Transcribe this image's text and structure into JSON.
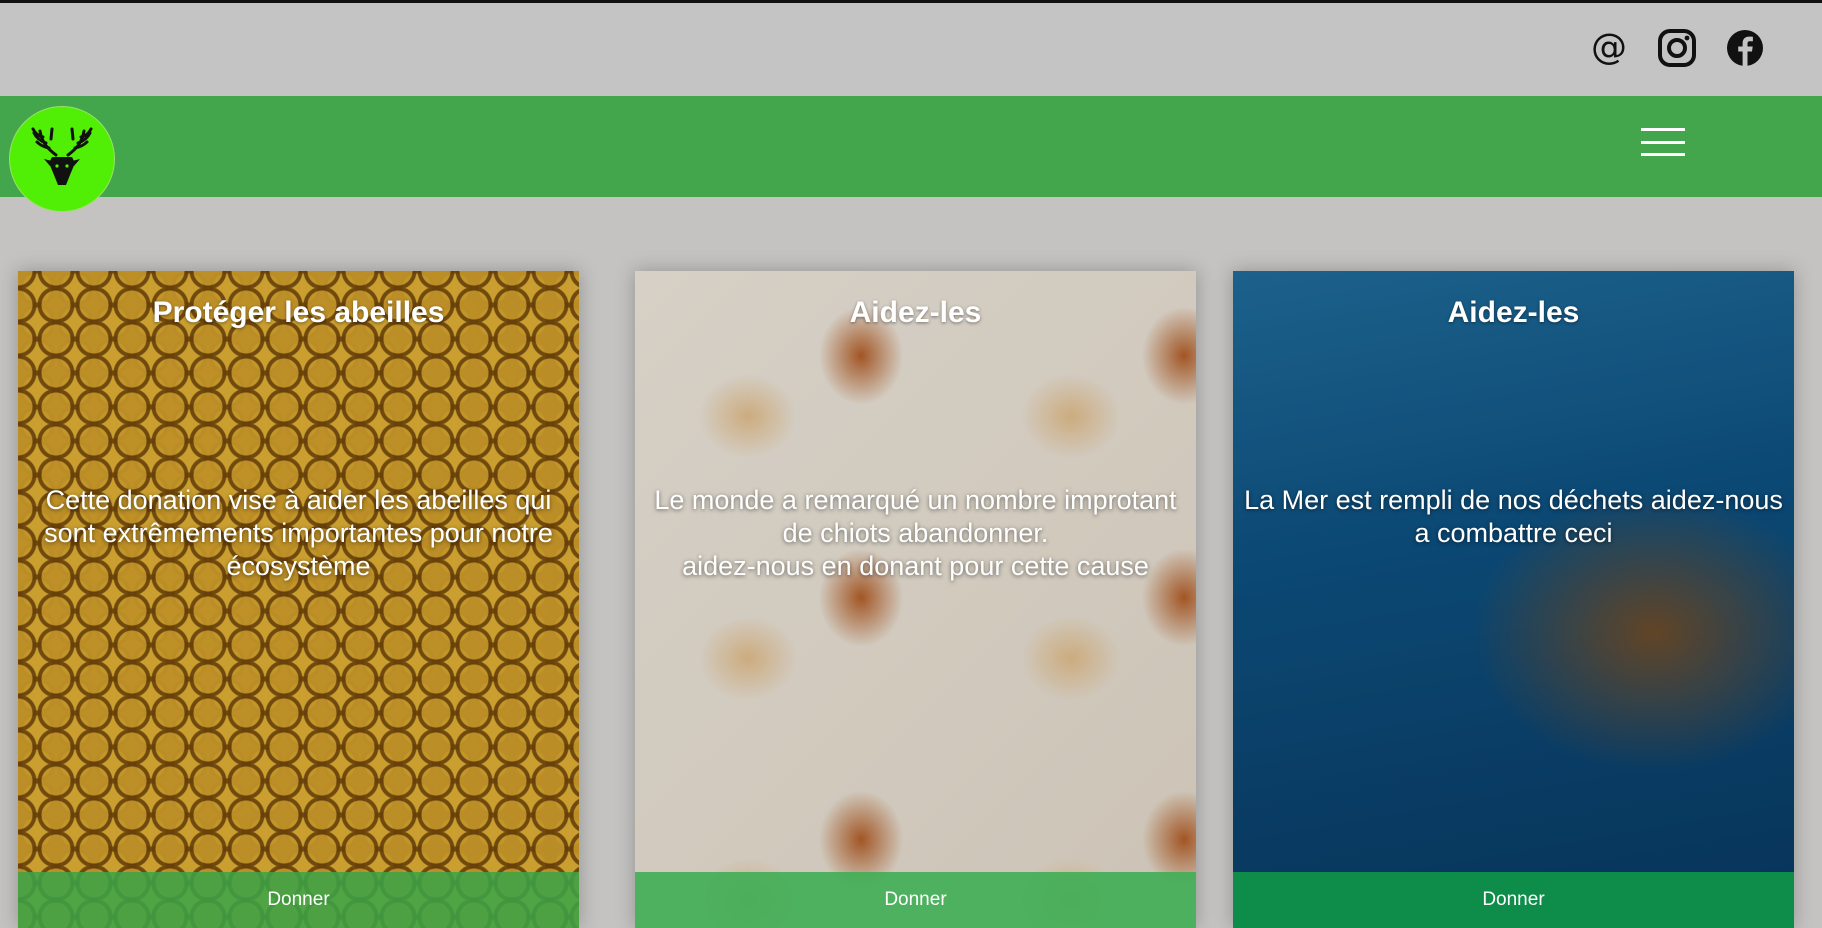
{
  "header": {
    "social": [
      {
        "name": "email",
        "icon": "at-icon",
        "label": "@"
      },
      {
        "name": "instagram",
        "icon": "instagram-icon"
      },
      {
        "name": "facebook",
        "icon": "facebook-icon"
      }
    ]
  },
  "navbar": {
    "color": "#43a64c",
    "logo_color": "#52ef06",
    "menu_icon": "hamburger-menu-icon"
  },
  "cards": [
    {
      "title": "Protéger les abeilles",
      "description": "Cette donation vise à aider les abeilles qui sont extrêmements importantes pour notre écosystème",
      "button": "Donner",
      "button_color": "#3aa548"
    },
    {
      "title": "Aidez-les",
      "description": "Le monde a remarqué un nombre improtant de chiots abandonner.\naidez-nous en donant pour cette cause",
      "button": "Donner",
      "button_color": "#3fae55"
    },
    {
      "title": "Aidez-les",
      "description": "La Mer est rempli de nos déchets aidez-nous a combattre ceci",
      "button": "Donner",
      "button_color": "#0e8c4a"
    }
  ]
}
